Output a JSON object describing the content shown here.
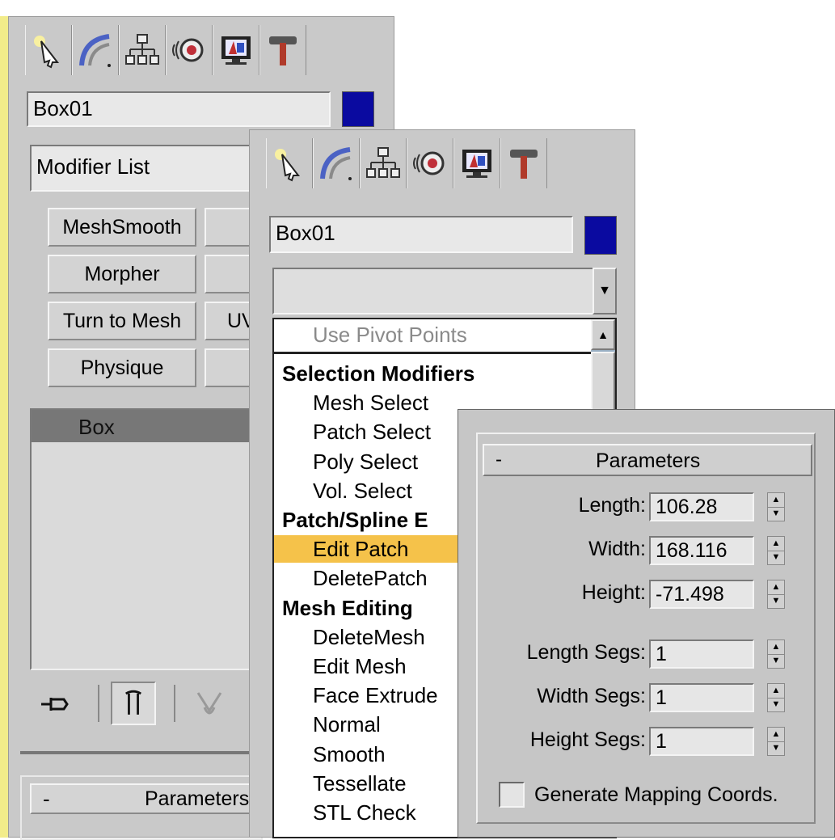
{
  "back_panel": {
    "object_name": "Box01",
    "modifier_list_label": "Modifier List",
    "buttons": [
      "MeshSmooth",
      "Morpher",
      "Turn to Mesh",
      "Physique"
    ],
    "partial_button_text": "UV",
    "stack_item": "Box",
    "parameters_label": "Parameters",
    "collapse_symbol": "-"
  },
  "front_panel": {
    "object_name": "Box01",
    "dropdown_arrow": "▼",
    "list_items": [
      {
        "text": "Use Pivot Points",
        "kind": "disabled"
      },
      {
        "text": "Selection Modifiers",
        "kind": "header"
      },
      {
        "text": "Mesh Select",
        "kind": "item"
      },
      {
        "text": "Patch Select",
        "kind": "item"
      },
      {
        "text": "Poly Select",
        "kind": "item"
      },
      {
        "text": "Vol. Select",
        "kind": "item"
      },
      {
        "text": "Patch/Spline E",
        "kind": "header"
      },
      {
        "text": "Edit Patch",
        "kind": "selected"
      },
      {
        "text": "DeletePatch",
        "kind": "item"
      },
      {
        "text": "Mesh Editing",
        "kind": "header"
      },
      {
        "text": "DeleteMesh",
        "kind": "item"
      },
      {
        "text": "Edit Mesh",
        "kind": "item"
      },
      {
        "text": "Face Extrude",
        "kind": "item"
      },
      {
        "text": "Normal",
        "kind": "item"
      },
      {
        "text": "Smooth",
        "kind": "item"
      },
      {
        "text": "Tessellate",
        "kind": "item"
      },
      {
        "text": "STL Check",
        "kind": "item"
      }
    ]
  },
  "parameters": {
    "title": "Parameters",
    "collapse_symbol": "-",
    "fields": [
      {
        "label": "Length:",
        "value": "106.28"
      },
      {
        "label": "Width:",
        "value": "168.116"
      },
      {
        "label": "Height:",
        "value": "-71.498"
      },
      {
        "label": "Length Segs:",
        "value": "1"
      },
      {
        "label": "Width Segs:",
        "value": "1"
      },
      {
        "label": "Height Segs:",
        "value": "1"
      }
    ],
    "checkbox_label": "Generate Mapping Coords.",
    "checkbox_checked": false
  },
  "colors": {
    "panel_bg": "#c9c9c9",
    "swatch": "#0a0aa0",
    "selection_highlight": "#f5c24a",
    "stack_selected": "#777777",
    "left_accent": "#f2ec8a"
  },
  "tab_icons": [
    "create-icon",
    "modify-icon",
    "hierarchy-icon",
    "motion-icon",
    "display-icon",
    "utilities-icon"
  ]
}
